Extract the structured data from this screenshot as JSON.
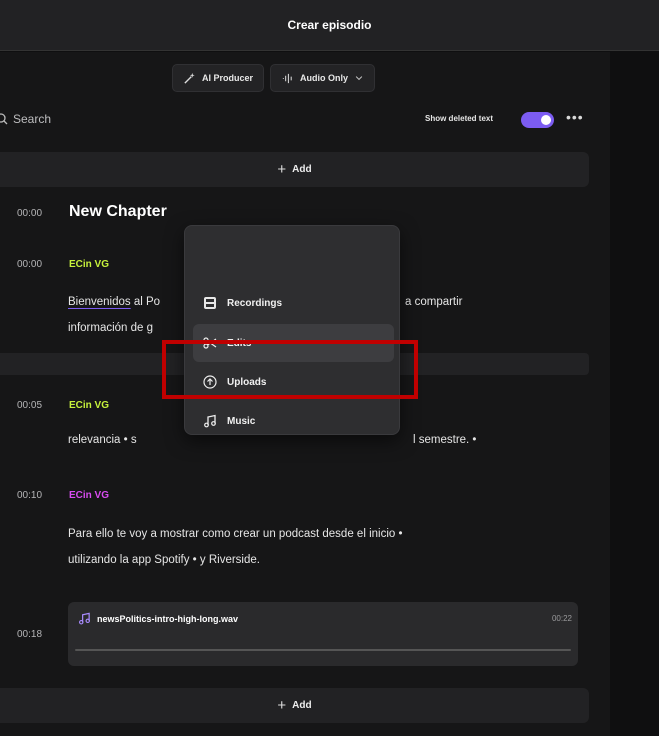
{
  "header": {
    "title": "Crear episodio"
  },
  "toolbar": {
    "ai_producer_label": "AI Producer",
    "audio_mode_label": "Audio Only"
  },
  "search": {
    "placeholder": "Search"
  },
  "options": {
    "show_deleted_label": "Show deleted text",
    "show_deleted_on": true,
    "more_label": "•••"
  },
  "add_label": "Add",
  "add_plus": "+",
  "chapter": {
    "time": "00:00",
    "title": "New Chapter"
  },
  "segments": [
    {
      "time": "00:00",
      "speaker": "ECin VG",
      "speaker_color": "#c7f23c",
      "line1_start": "Bienvenidos",
      "line1_rest": " al Po",
      "line1_end": "a compartir",
      "line2": "información de g"
    },
    {
      "time": "00:05",
      "speaker": "ECin VG",
      "speaker_color": "#c7f23c",
      "line1_start": "relevancia • s",
      "line1_end": "l semestre. •"
    },
    {
      "time": "00:10",
      "speaker": "ECin VG",
      "speaker_color": "#d84cf0",
      "line1": "Para ello te voy a mostrar como crear un podcast desde el inicio •",
      "line2": "utilizando la app Spotify • y Riverside."
    }
  ],
  "music_clip": {
    "time": "00:18",
    "filename": "newsPolitics-intro-high-long.wav",
    "duration": "00:22"
  },
  "menu": {
    "items": [
      {
        "label": "Recordings",
        "icon": "recordings-icon"
      },
      {
        "label": "Edits",
        "icon": "scissors-icon"
      },
      {
        "label": "Uploads",
        "icon": "upload-icon"
      },
      {
        "label": "Music",
        "icon": "music-note-icon"
      }
    ]
  },
  "colors": {
    "accent": "#7c5cf2",
    "highlight_box": "#c00000"
  }
}
